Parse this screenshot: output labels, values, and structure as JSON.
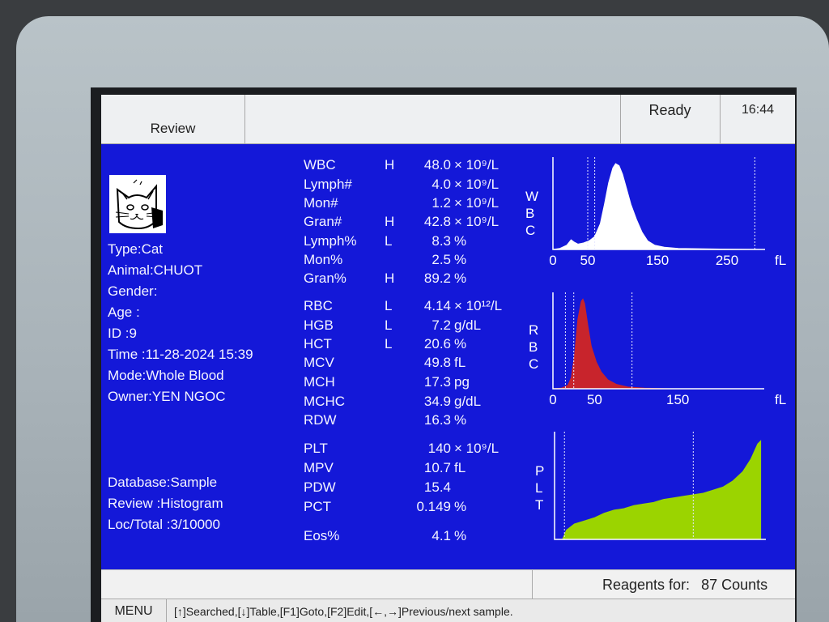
{
  "header": {
    "tab_review": "Review",
    "status": "Ready",
    "time": "16:44"
  },
  "sample": {
    "type": "Type:Cat",
    "animal": "Animal:CHUOT",
    "gender": "Gender:",
    "age": "Age  :",
    "id": "ID    :9",
    "time": "Time :11-28-2024 15:39",
    "mode": "Mode:Whole Blood",
    "owner": "Owner:YEN NGOC",
    "database": "Database:Sample",
    "review": "Review    :Histogram",
    "loc_total": "Loc/Total :3/10000"
  },
  "params": [
    {
      "name": "WBC",
      "flag": "H",
      "value": "48.0",
      "unit": "× 10⁹/L"
    },
    {
      "name": "Lymph#",
      "flag": "",
      "value": "4.0",
      "unit": "× 10⁹/L"
    },
    {
      "name": "Mon#",
      "flag": "",
      "value": "1.2",
      "unit": "× 10⁹/L"
    },
    {
      "name": "Gran#",
      "flag": "H",
      "value": "42.8",
      "unit": "× 10⁹/L"
    },
    {
      "name": "Lymph%",
      "flag": "L",
      "value": "8.3",
      "unit": "%"
    },
    {
      "name": "Mon%",
      "flag": "",
      "value": "2.5",
      "unit": "%"
    },
    {
      "name": "Gran%",
      "flag": "H",
      "value": "89.2",
      "unit": "%"
    },
    {
      "name": "RBC",
      "flag": "L",
      "value": "4.14",
      "unit": "× 10¹²/L"
    },
    {
      "name": "HGB",
      "flag": "L",
      "value": "7.2",
      "unit": "g/dL"
    },
    {
      "name": "HCT",
      "flag": "L",
      "value": "20.6",
      "unit": "%"
    },
    {
      "name": "MCV",
      "flag": "",
      "value": "49.8",
      "unit": "fL"
    },
    {
      "name": "MCH",
      "flag": "",
      "value": "17.3",
      "unit": "pg"
    },
    {
      "name": "MCHC",
      "flag": "",
      "value": "34.9",
      "unit": "g/dL"
    },
    {
      "name": "RDW",
      "flag": "",
      "value": "16.3",
      "unit": "%"
    },
    {
      "name": "PLT",
      "flag": "",
      "value": "140",
      "unit": "× 10⁹/L"
    },
    {
      "name": "MPV",
      "flag": "",
      "value": "10.7",
      "unit": "fL"
    },
    {
      "name": "PDW",
      "flag": "",
      "value": "15.4",
      "unit": ""
    },
    {
      "name": "PCT",
      "flag": "",
      "value": "0.149",
      "unit": "%"
    },
    {
      "name": "Eos%",
      "flag": "",
      "value": "4.1",
      "unit": "%"
    }
  ],
  "histograms": {
    "unit_label": "fL",
    "wbc": {
      "label": [
        "W",
        "B",
        "C"
      ],
      "ticks": [
        "0",
        "50",
        "150",
        "250"
      ],
      "color": "#ffffff",
      "x_range": [
        0,
        300
      ],
      "discriminators": [
        0,
        50,
        60,
        290
      ],
      "points": [
        [
          0,
          0
        ],
        [
          10,
          1
        ],
        [
          20,
          4
        ],
        [
          26,
          9
        ],
        [
          30,
          7
        ],
        [
          36,
          5
        ],
        [
          44,
          6
        ],
        [
          52,
          8
        ],
        [
          60,
          12
        ],
        [
          68,
          24
        ],
        [
          74,
          42
        ],
        [
          80,
          62
        ],
        [
          86,
          76
        ],
        [
          90,
          80
        ],
        [
          95,
          78
        ],
        [
          100,
          70
        ],
        [
          106,
          56
        ],
        [
          112,
          42
        ],
        [
          120,
          28
        ],
        [
          128,
          16
        ],
        [
          136,
          8
        ],
        [
          146,
          4
        ],
        [
          160,
          2
        ],
        [
          180,
          1
        ],
        [
          220,
          0.5
        ],
        [
          300,
          0
        ]
      ]
    },
    "rbc": {
      "label": [
        "R",
        "B",
        "C"
      ],
      "ticks": [
        "0",
        "50",
        "150"
      ],
      "color": "#c8242c",
      "x_range": [
        0,
        250
      ],
      "discriminators": [
        15,
        25,
        95
      ],
      "points": [
        [
          0,
          0
        ],
        [
          10,
          0.5
        ],
        [
          18,
          3
        ],
        [
          22,
          10
        ],
        [
          26,
          30
        ],
        [
          30,
          62
        ],
        [
          34,
          78
        ],
        [
          36,
          80
        ],
        [
          38,
          76
        ],
        [
          42,
          56
        ],
        [
          46,
          38
        ],
        [
          52,
          24
        ],
        [
          58,
          15
        ],
        [
          66,
          8
        ],
        [
          76,
          4
        ],
        [
          90,
          1.5
        ],
        [
          110,
          0.5
        ],
        [
          140,
          0
        ],
        [
          250,
          0
        ]
      ]
    },
    "plt": {
      "label": [
        "P",
        "L",
        "T"
      ],
      "ticks": [
        "0",
        "5",
        "10",
        "15",
        "20"
      ],
      "color": "#9bd400",
      "x_range": [
        0,
        21
      ],
      "discriminators": [
        1,
        14
      ],
      "points": [
        [
          0.8,
          0
        ],
        [
          1.2,
          6
        ],
        [
          2,
          10
        ],
        [
          3,
          12
        ],
        [
          4,
          14
        ],
        [
          5,
          17
        ],
        [
          6,
          19
        ],
        [
          7,
          20
        ],
        [
          8,
          22
        ],
        [
          9,
          23
        ],
        [
          10,
          24
        ],
        [
          11,
          26
        ],
        [
          12,
          27
        ],
        [
          13,
          28
        ],
        [
          14,
          29
        ],
        [
          15,
          30
        ],
        [
          16,
          32
        ],
        [
          17,
          34
        ],
        [
          18,
          38
        ],
        [
          19,
          44
        ],
        [
          19.8,
          52
        ],
        [
          20.5,
          62
        ],
        [
          20.8,
          64
        ],
        [
          20.8,
          0
        ]
      ]
    }
  },
  "footer": {
    "reagent_label": "Reagents for:",
    "reagent_value": "87 Counts",
    "menu": "MENU",
    "hint": "[↑]Searched,[↓]Table,[F1]Goto,[F2]Edit,[←,→]Previous/next sample."
  }
}
